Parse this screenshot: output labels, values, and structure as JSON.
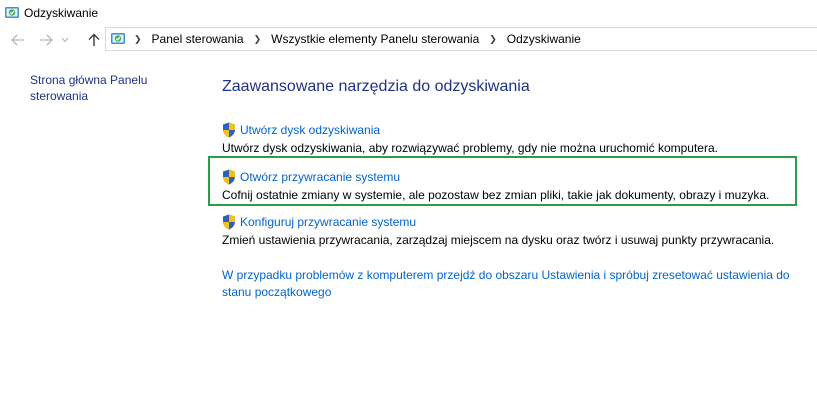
{
  "window": {
    "title": "Odzyskiwanie"
  },
  "nav": {
    "back_icon": "arrow-left-icon",
    "forward_icon": "arrow-right-icon",
    "up_icon": "arrow-up-icon",
    "breadcrumbs": [
      "Panel sterowania",
      "Wszystkie elementy Panelu sterowania",
      "Odzyskiwanie"
    ]
  },
  "sidebar": {
    "home_link": "Strona główna Panelu sterowania"
  },
  "main": {
    "heading": "Zaawansowane narzędzia do odzyskiwania",
    "tools": [
      {
        "icon": "uac-shield-icon",
        "link": "Utwórz dysk odzyskiwania",
        "description": "Utwórz dysk odzyskiwania, aby rozwiązywać problemy, gdy nie można uruchomić komputera."
      },
      {
        "icon": "uac-shield-icon",
        "link": "Otwórz przywracanie systemu",
        "description": "Cofnij ostatnie zmiany w systemie, ale pozostaw bez zmian pliki, takie jak dokumenty, obrazy i muzyka."
      },
      {
        "icon": "uac-shield-icon",
        "link": "Konfiguruj przywracanie systemu",
        "description": "Zmień ustawienia przywracania, zarządzaj miejscem na dysku oraz twórz i usuwaj punkty przywracania."
      }
    ],
    "reset_link": "W przypadku problemów z komputerem przejdź do obszaru Ustawienia i spróbuj zresetować ustawienia do stanu początkowego"
  },
  "colors": {
    "link": "#0066cc",
    "heading": "#1e3287",
    "highlight_border": "#2e9b45"
  }
}
